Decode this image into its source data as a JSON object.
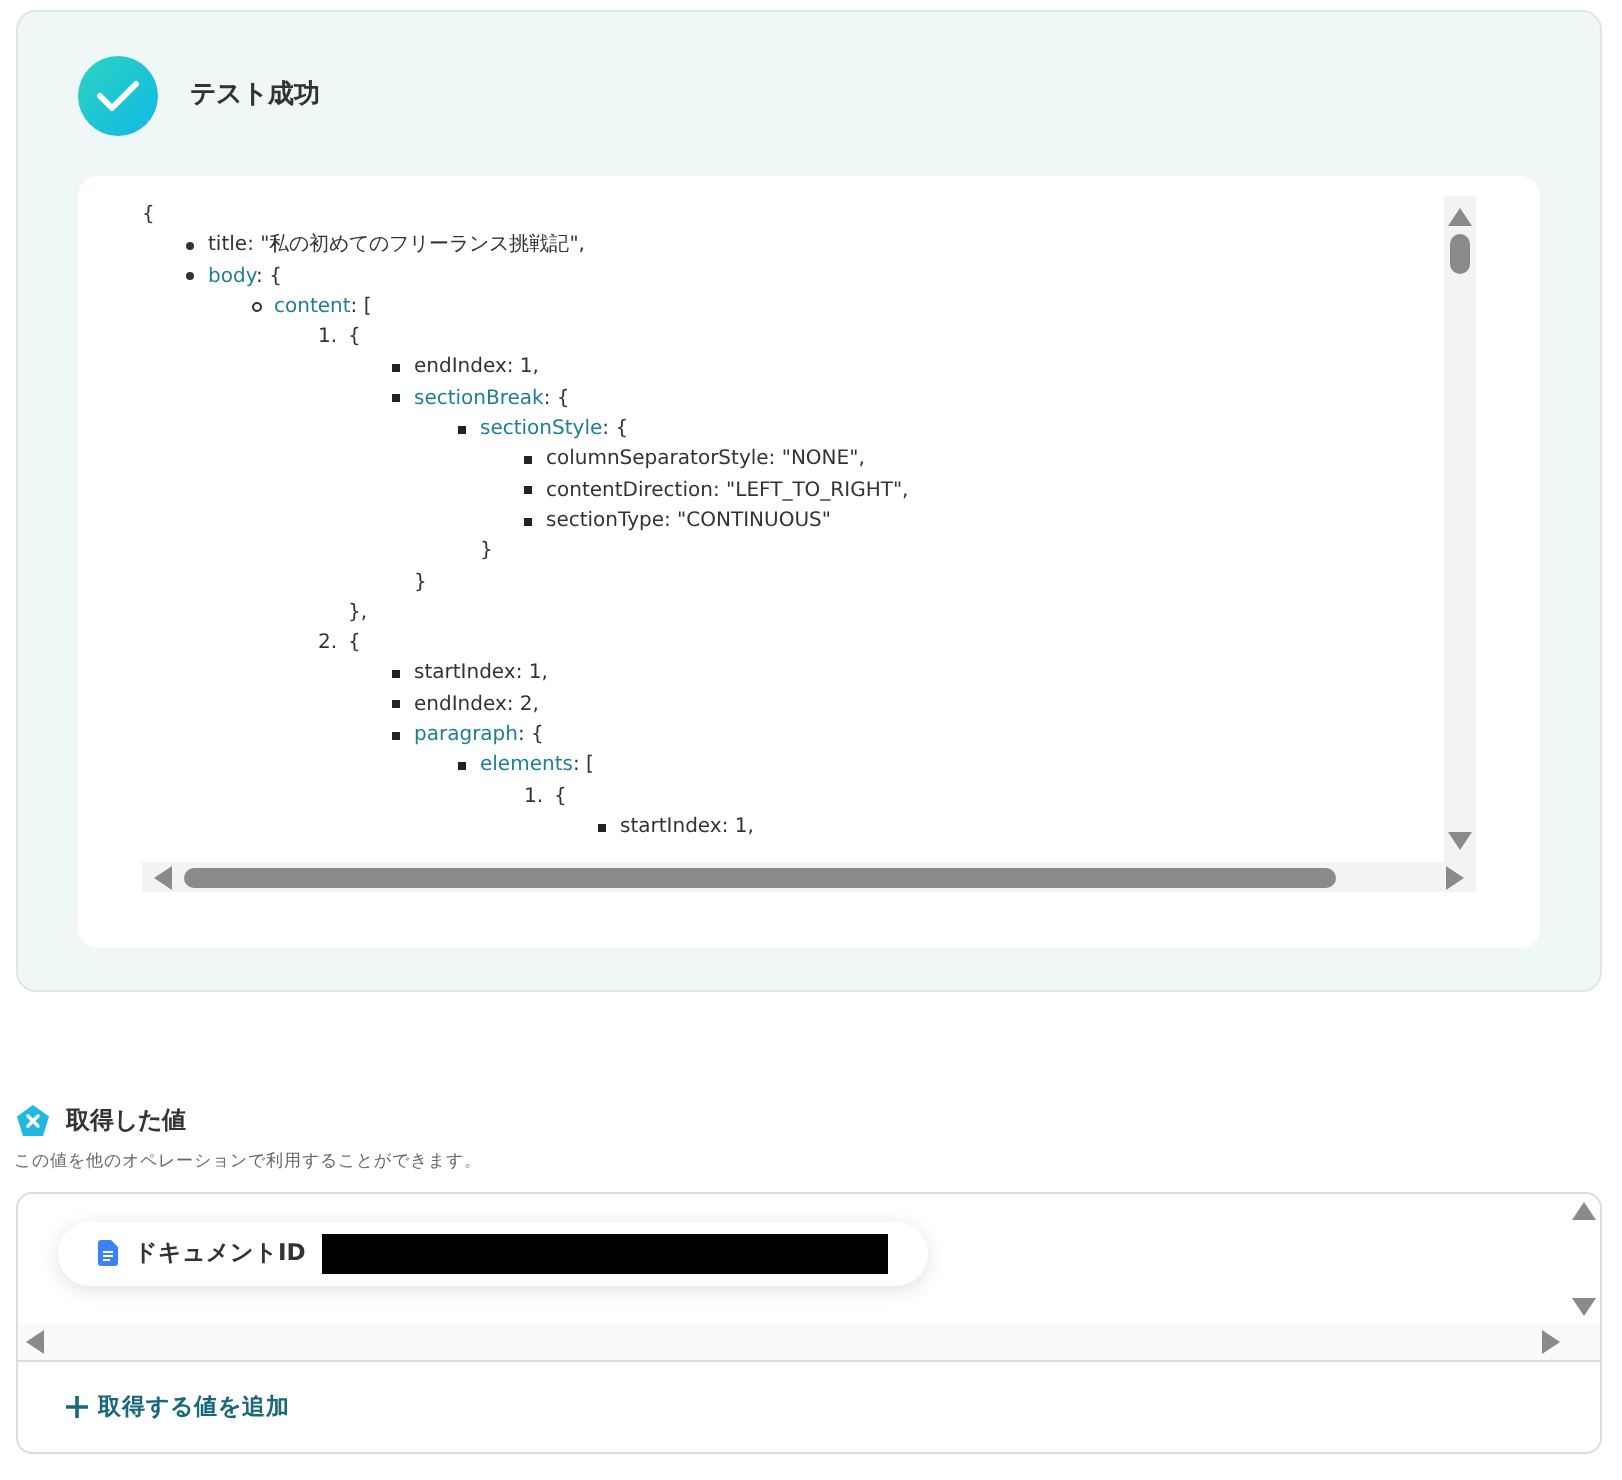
{
  "result": {
    "title": "テスト成功",
    "success": true,
    "code": {
      "open": "{",
      "items": [
        {
          "kind": "disc",
          "key": "title",
          "linked": false,
          "text": ": \"私の初めてのフリーランス挑戦記\","
        },
        {
          "kind": "disc",
          "key": "body",
          "linked": true,
          "text": ": {",
          "children": [
            {
              "kind": "circle",
              "key": "content",
              "linked": true,
              "text": ": [",
              "children": [
                {
                  "kind": "number",
                  "number": "1.",
                  "text": "{",
                  "close": "},",
                  "children": [
                    {
                      "kind": "square",
                      "key": "endIndex",
                      "linked": false,
                      "text": ": 1,"
                    },
                    {
                      "kind": "square",
                      "key": "sectionBreak",
                      "linked": true,
                      "text": ": {",
                      "close": "}",
                      "children": [
                        {
                          "kind": "square",
                          "key": "sectionStyle",
                          "linked": true,
                          "text": ": {",
                          "close": "}",
                          "children": [
                            {
                              "kind": "square",
                              "key": "columnSeparatorStyle",
                              "linked": false,
                              "text": ": \"NONE\","
                            },
                            {
                              "kind": "square",
                              "key": "contentDirection",
                              "linked": false,
                              "text": ": \"LEFT_TO_RIGHT\","
                            },
                            {
                              "kind": "square",
                              "key": "sectionType",
                              "linked": false,
                              "text": ": \"CONTINUOUS\""
                            }
                          ]
                        }
                      ]
                    }
                  ]
                },
                {
                  "kind": "number",
                  "number": "2.",
                  "text": "{",
                  "children": [
                    {
                      "kind": "square",
                      "key": "startIndex",
                      "linked": false,
                      "text": ": 1,"
                    },
                    {
                      "kind": "square",
                      "key": "endIndex",
                      "linked": false,
                      "text": ": 2,"
                    },
                    {
                      "kind": "square",
                      "key": "paragraph",
                      "linked": true,
                      "text": ": {",
                      "children": [
                        {
                          "kind": "square",
                          "key": "elements",
                          "linked": true,
                          "text": ": [",
                          "children": [
                            {
                              "kind": "number",
                              "number": "1.",
                              "text": "{",
                              "children": [
                                {
                                  "kind": "square",
                                  "key": "startIndex",
                                  "linked": false,
                                  "text": ": 1,"
                                }
                              ]
                            }
                          ]
                        }
                      ]
                    }
                  ]
                }
              ]
            }
          ]
        }
      ]
    }
  },
  "output": {
    "title": "取得した値",
    "description": "この値を他のオペレーションで利用することができます。",
    "fields": [
      {
        "label": "ドキュメントID",
        "redacted": true
      }
    ],
    "add_button": "取得する値を追加"
  }
}
